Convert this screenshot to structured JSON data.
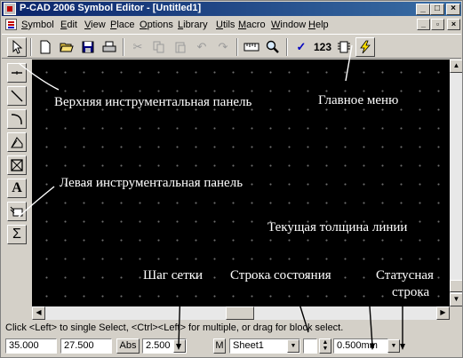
{
  "window": {
    "title": "P-CAD 2006 Symbol Editor - [Untitled1]"
  },
  "menu": {
    "items": [
      "Symbol",
      "Edit",
      "View",
      "Place",
      "Options",
      "Library",
      "Utils",
      "Macro",
      "Window",
      "Help"
    ]
  },
  "toolbar": {
    "icons": [
      "select-arrow-icon",
      "new-icon",
      "open-icon",
      "save-icon",
      "print-icon",
      "cut-icon",
      "copy-icon",
      "paste-icon",
      "undo-icon",
      "redo-icon",
      "ruler-icon",
      "zoom-icon",
      "check-icon",
      "number-icon",
      "component-icon",
      "lightning-icon"
    ],
    "number_label": "123"
  },
  "left_toolbar": {
    "icons": [
      "pin-icon",
      "line-icon",
      "arc-icon",
      "polygon-icon",
      "box-x-icon",
      "text-icon",
      "attribute-icon",
      "sigma-icon"
    ],
    "text_tool_label": "A"
  },
  "annotations": {
    "top_toolbar": "Верхняя инструментальная панель",
    "main_menu": "Главное меню",
    "left_toolbar": "Левая инструментальная панель",
    "line_width": "Текущая толщина линии",
    "grid_step": "Шаг сетки",
    "status_line": "Строка состояния",
    "status_bar_line1": "Статусная",
    "status_bar_line2": "строка"
  },
  "status": {
    "message": "Click <Left> to single Select, <Ctrl><Left> for multiple, or drag for block select.",
    "x": "35.000",
    "y": "27.500",
    "abs_label": "Abs",
    "grid": "2.500",
    "m_label": "M",
    "sheet": "Sheet1",
    "line_width": "0.500mm"
  }
}
